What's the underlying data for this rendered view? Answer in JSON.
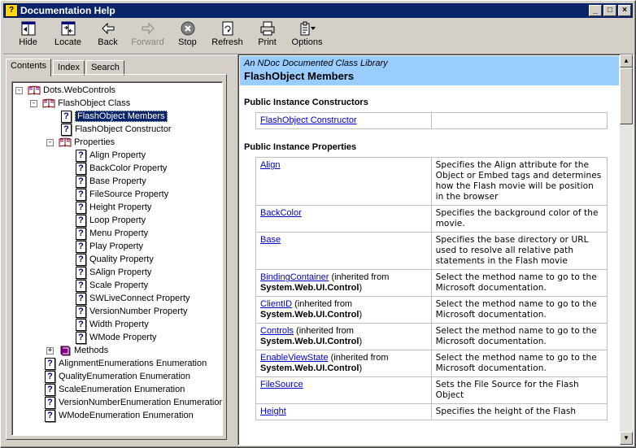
{
  "window": {
    "title": "Documentation Help",
    "controls": {
      "minimize": "_",
      "maximize": "□",
      "close": "×"
    }
  },
  "toolbar": {
    "buttons": [
      {
        "label": "Hide",
        "icon": "hide-icon",
        "enabled": true
      },
      {
        "label": "Locate",
        "icon": "locate-icon",
        "enabled": true
      },
      {
        "label": "Back",
        "icon": "back-arrow-icon",
        "enabled": true
      },
      {
        "label": "Forward",
        "icon": "forward-arrow-icon",
        "enabled": false
      },
      {
        "label": "Stop",
        "icon": "stop-icon",
        "enabled": true
      },
      {
        "label": "Refresh",
        "icon": "refresh-icon",
        "enabled": true
      },
      {
        "label": "Print",
        "icon": "print-icon",
        "enabled": true
      },
      {
        "label": "Options",
        "icon": "options-icon",
        "enabled": true
      }
    ]
  },
  "nav": {
    "tabs": [
      "Contents",
      "Index",
      "Search"
    ],
    "active_tab": "Contents",
    "tree": [
      {
        "label": "Dots.WebControls",
        "type": "book-open",
        "level": 0,
        "expander": "-"
      },
      {
        "label": "FlashObject Class",
        "type": "book-open",
        "level": 1,
        "expander": "-"
      },
      {
        "label": "FlashObject Members",
        "type": "page",
        "level": 2,
        "selected": true
      },
      {
        "label": "FlashObject Constructor",
        "type": "page",
        "level": 2
      },
      {
        "label": "Properties",
        "type": "book-open",
        "level": 2,
        "expander": "-"
      },
      {
        "label": "Align Property",
        "type": "page",
        "level": 3
      },
      {
        "label": "BackColor Property",
        "type": "page",
        "level": 3
      },
      {
        "label": "Base Property",
        "type": "page",
        "level": 3
      },
      {
        "label": "FileSource Property",
        "type": "page",
        "level": 3
      },
      {
        "label": "Height Property",
        "type": "page",
        "level": 3
      },
      {
        "label": "Loop Property",
        "type": "page",
        "level": 3
      },
      {
        "label": "Menu Property",
        "type": "page",
        "level": 3
      },
      {
        "label": "Play Property",
        "type": "page",
        "level": 3
      },
      {
        "label": "Quality Property",
        "type": "page",
        "level": 3
      },
      {
        "label": "SAlign Property",
        "type": "page",
        "level": 3
      },
      {
        "label": "Scale Property",
        "type": "page",
        "level": 3
      },
      {
        "label": "SWLiveConnect Property",
        "type": "page",
        "level": 3
      },
      {
        "label": "VersionNumber Property",
        "type": "page",
        "level": 3
      },
      {
        "label": "Width Property",
        "type": "page",
        "level": 3
      },
      {
        "label": "WMode Property",
        "type": "page",
        "level": 3
      },
      {
        "label": "Methods",
        "type": "book-closed",
        "level": 2,
        "expander": "+"
      },
      {
        "label": "AlignmentEnumerations Enumeration",
        "type": "page",
        "level": 1
      },
      {
        "label": "QualityEnumeration Enumeration",
        "type": "page",
        "level": 1
      },
      {
        "label": "ScaleEnumeration Enumeration",
        "type": "page",
        "level": 1
      },
      {
        "label": "VersionNumberEnumeration Enumeration",
        "type": "page",
        "level": 1
      },
      {
        "label": "WModeEnumeration Enumeration",
        "type": "page",
        "level": 1
      }
    ]
  },
  "doc": {
    "library": "An NDoc Documented Class Library",
    "title": "FlashObject Members",
    "sections": [
      {
        "heading": "Public Instance Constructors",
        "rows": [
          {
            "name": "FlashObject Constructor",
            "inherited": "",
            "from": "",
            "desc": ""
          }
        ]
      },
      {
        "heading": "Public Instance Properties",
        "rows": [
          {
            "name": "Align",
            "inherited": "",
            "from": "",
            "desc": "Specifies the Align attribute for the Object or Embed tags and determines how the Flash movie will be position in the browser"
          },
          {
            "name": "BackColor",
            "inherited": "",
            "from": "",
            "desc": "Specifies the background color of the movie."
          },
          {
            "name": "Base",
            "inherited": "",
            "from": "",
            "desc": "Specifies the base directory or URL used to resolve all relative path statements in the Flash movie"
          },
          {
            "name": "BindingContainer",
            "inherited": " (inherited from ",
            "from": "System.Web.UI.Control",
            "close": ")",
            "desc": "Select the method name to go to the Microsoft documentation."
          },
          {
            "name": "ClientID",
            "inherited": " (inherited from ",
            "from": "System.Web.UI.Control",
            "close": ")",
            "desc": "Select the method name to go to the Microsoft documentation."
          },
          {
            "name": "Controls",
            "inherited": " (inherited from ",
            "from": "System.Web.UI.Control",
            "close": ")",
            "desc": "Select the method name to go to the Microsoft documentation."
          },
          {
            "name": "EnableViewState",
            "inherited": " (inherited from ",
            "from": "System.Web.UI.Control",
            "close": ")",
            "desc": "Select the method name to go to the Microsoft documentation."
          },
          {
            "name": "FileSource",
            "inherited": "",
            "from": "",
            "desc": "Sets the File Source for the Flash Object"
          },
          {
            "name": "Height",
            "inherited": "",
            "from": "",
            "desc": "Specifies the height of the Flash"
          }
        ]
      }
    ]
  },
  "scrollbar": {
    "up": "▲",
    "down": "▼"
  }
}
